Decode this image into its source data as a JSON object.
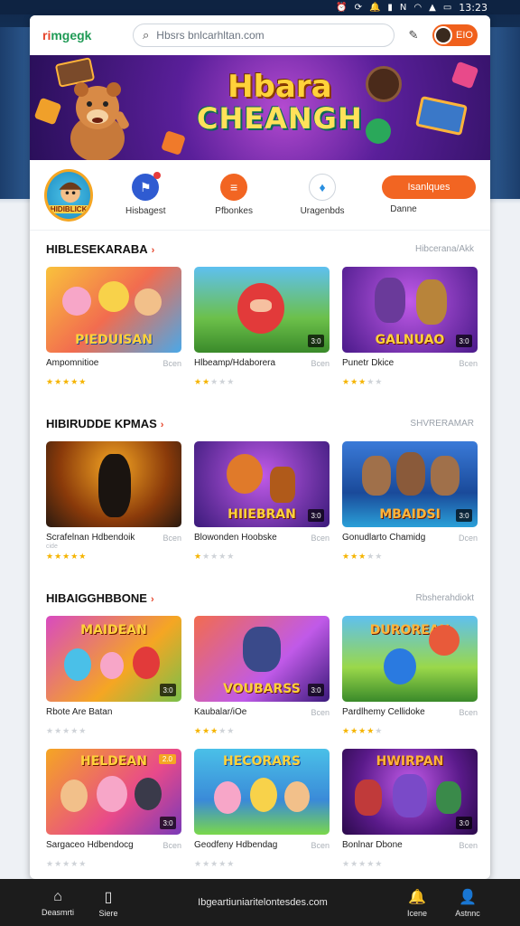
{
  "status_bar": {
    "time": "13:23",
    "icons": [
      "alarm-icon",
      "sync-icon",
      "notification-icon",
      "sim-icon",
      "nfc-icon",
      "wifi-icon",
      "signal-icon",
      "battery-icon"
    ]
  },
  "header": {
    "logo": "mgegk",
    "logo_prefix": "ri",
    "search_placeholder": "Hbsrs bnlcarhltan.com",
    "account_label": "EIO"
  },
  "banner": {
    "line1": "Hbara",
    "line2": "CHEANGH"
  },
  "categories": {
    "featured_label": "HIDIBLICK",
    "items": [
      {
        "label": "Hisbagest",
        "icon": "flag-icon",
        "color": "#2f5bd1"
      },
      {
        "label": "Pfbonkes",
        "icon": "burger-icon",
        "color": "#f26522"
      },
      {
        "label": "Uragenbds",
        "icon": "bird-icon",
        "color": "#2a8fe0"
      }
    ],
    "button_label": "Danne",
    "cta_label": "Isanlques"
  },
  "sections": [
    {
      "title": "HIBLESEKARABA",
      "more": "Hibcerana/Akk",
      "cards": [
        {
          "thumb_title": "PIEDUISAN",
          "name": "Ampomnitioe",
          "side": "Bcen",
          "sub": "",
          "rating": 5,
          "badge": "",
          "tag": ""
        },
        {
          "thumb_title": "",
          "name": "Hlbeamp/Hdaborera",
          "side": "Bcen",
          "sub": "",
          "rating": 2,
          "badge": "3:0",
          "tag": ""
        },
        {
          "thumb_title": "GALNUAO",
          "name": "Punetr Dkice",
          "side": "Bcen",
          "sub": "",
          "rating": 3,
          "badge": "3:0",
          "tag": ""
        }
      ]
    },
    {
      "title": "HIBIRUDDE KPMAS",
      "more": "SHVRERAMAR",
      "cards": [
        {
          "thumb_title": "",
          "name": "Scrafelnan Hdbendoik",
          "side": "Bcen",
          "sub": "cide",
          "rating": 5,
          "badge": "",
          "tag": ""
        },
        {
          "thumb_title": "HIIEBRAN",
          "name": "Blowonden Hoobske",
          "side": "Bcen",
          "sub": "",
          "rating": 1,
          "badge": "3:0",
          "tag": ""
        },
        {
          "thumb_title": "MBAIDSI",
          "name": "Gonudlarto Chamidg",
          "side": "Dcen",
          "sub": "",
          "rating": 3,
          "badge": "3:0",
          "tag": ""
        }
      ]
    },
    {
      "title": "HIBAIGGHBBONE",
      "more": "Rbsherahdiokt",
      "cards": [
        {
          "thumb_title": "MAIDEAN",
          "name": "Rbote Are Batan",
          "side": "",
          "sub": "",
          "rating": 0,
          "badge": "3:0",
          "tag": ""
        },
        {
          "thumb_title": "VOUBARSS",
          "name": "Kaubalar/iOe",
          "side": "Bcen",
          "sub": "",
          "rating": 3,
          "badge": "3:0",
          "tag": ""
        },
        {
          "thumb_title": "DUROREAN",
          "name": "Pardlhemy Cellidoke",
          "side": "Bcen",
          "sub": "",
          "rating": 4,
          "badge": "",
          "tag": ""
        },
        {
          "thumb_title": "HELDEAN",
          "name": "Sargaceo Hdbendocg",
          "side": "Bcen",
          "sub": "",
          "rating": 0,
          "badge": "3:0",
          "tag": "2.0"
        },
        {
          "thumb_title": "HECORARS",
          "name": "Geodfeny Hdbendag",
          "side": "Bcen",
          "sub": "",
          "rating": 0,
          "badge": "",
          "tag": ""
        },
        {
          "thumb_title": "HWIRPAN",
          "name": "Bonlnar Dbone",
          "side": "Bcen",
          "sub": "",
          "rating": 0,
          "badge": "3:0",
          "tag": ""
        }
      ]
    }
  ],
  "bottom_nav": {
    "home_label": "Deasmrti",
    "apps_label": "Siere",
    "url": "Ibgeartiuniaritelontesdes.com",
    "notify_label": "Icene",
    "profile_label": "Astnnc"
  }
}
